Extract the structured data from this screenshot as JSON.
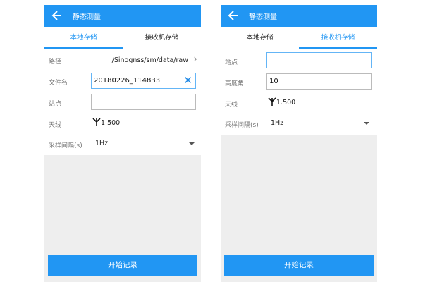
{
  "left": {
    "title": "静态测量",
    "tabs": [
      {
        "label": "本地存储",
        "active": true
      },
      {
        "label": "接收机存储",
        "active": false
      }
    ],
    "path_label": "路径",
    "path_value": "/Sinognss/sm/data/raw",
    "filename_label": "文件名",
    "filename_value": "20180226_114833",
    "station_label": "站点",
    "station_value": "",
    "antenna_label": "天线",
    "antenna_value": "1.500",
    "interval_label": "采样间隔(s)",
    "interval_value": "1Hz",
    "start_button": "开始记录"
  },
  "right": {
    "title": "静态测量",
    "tabs": [
      {
        "label": "本地存储",
        "active": false
      },
      {
        "label": "接收机存储",
        "active": true
      }
    ],
    "station_label": "站点",
    "station_value": "",
    "mask_label": "高度角",
    "mask_value": "10",
    "antenna_label": "天线",
    "antenna_value": "1.500",
    "interval_label": "采样间隔(s)",
    "interval_value": "1Hz",
    "start_button": "开始记录"
  },
  "colors": {
    "accent": "#2196f3",
    "background": "#eeeeee"
  },
  "icons": [
    "back-arrow-icon",
    "chevron-right-icon",
    "clear-icon",
    "antenna-icon",
    "dropdown-arrow-icon"
  ]
}
